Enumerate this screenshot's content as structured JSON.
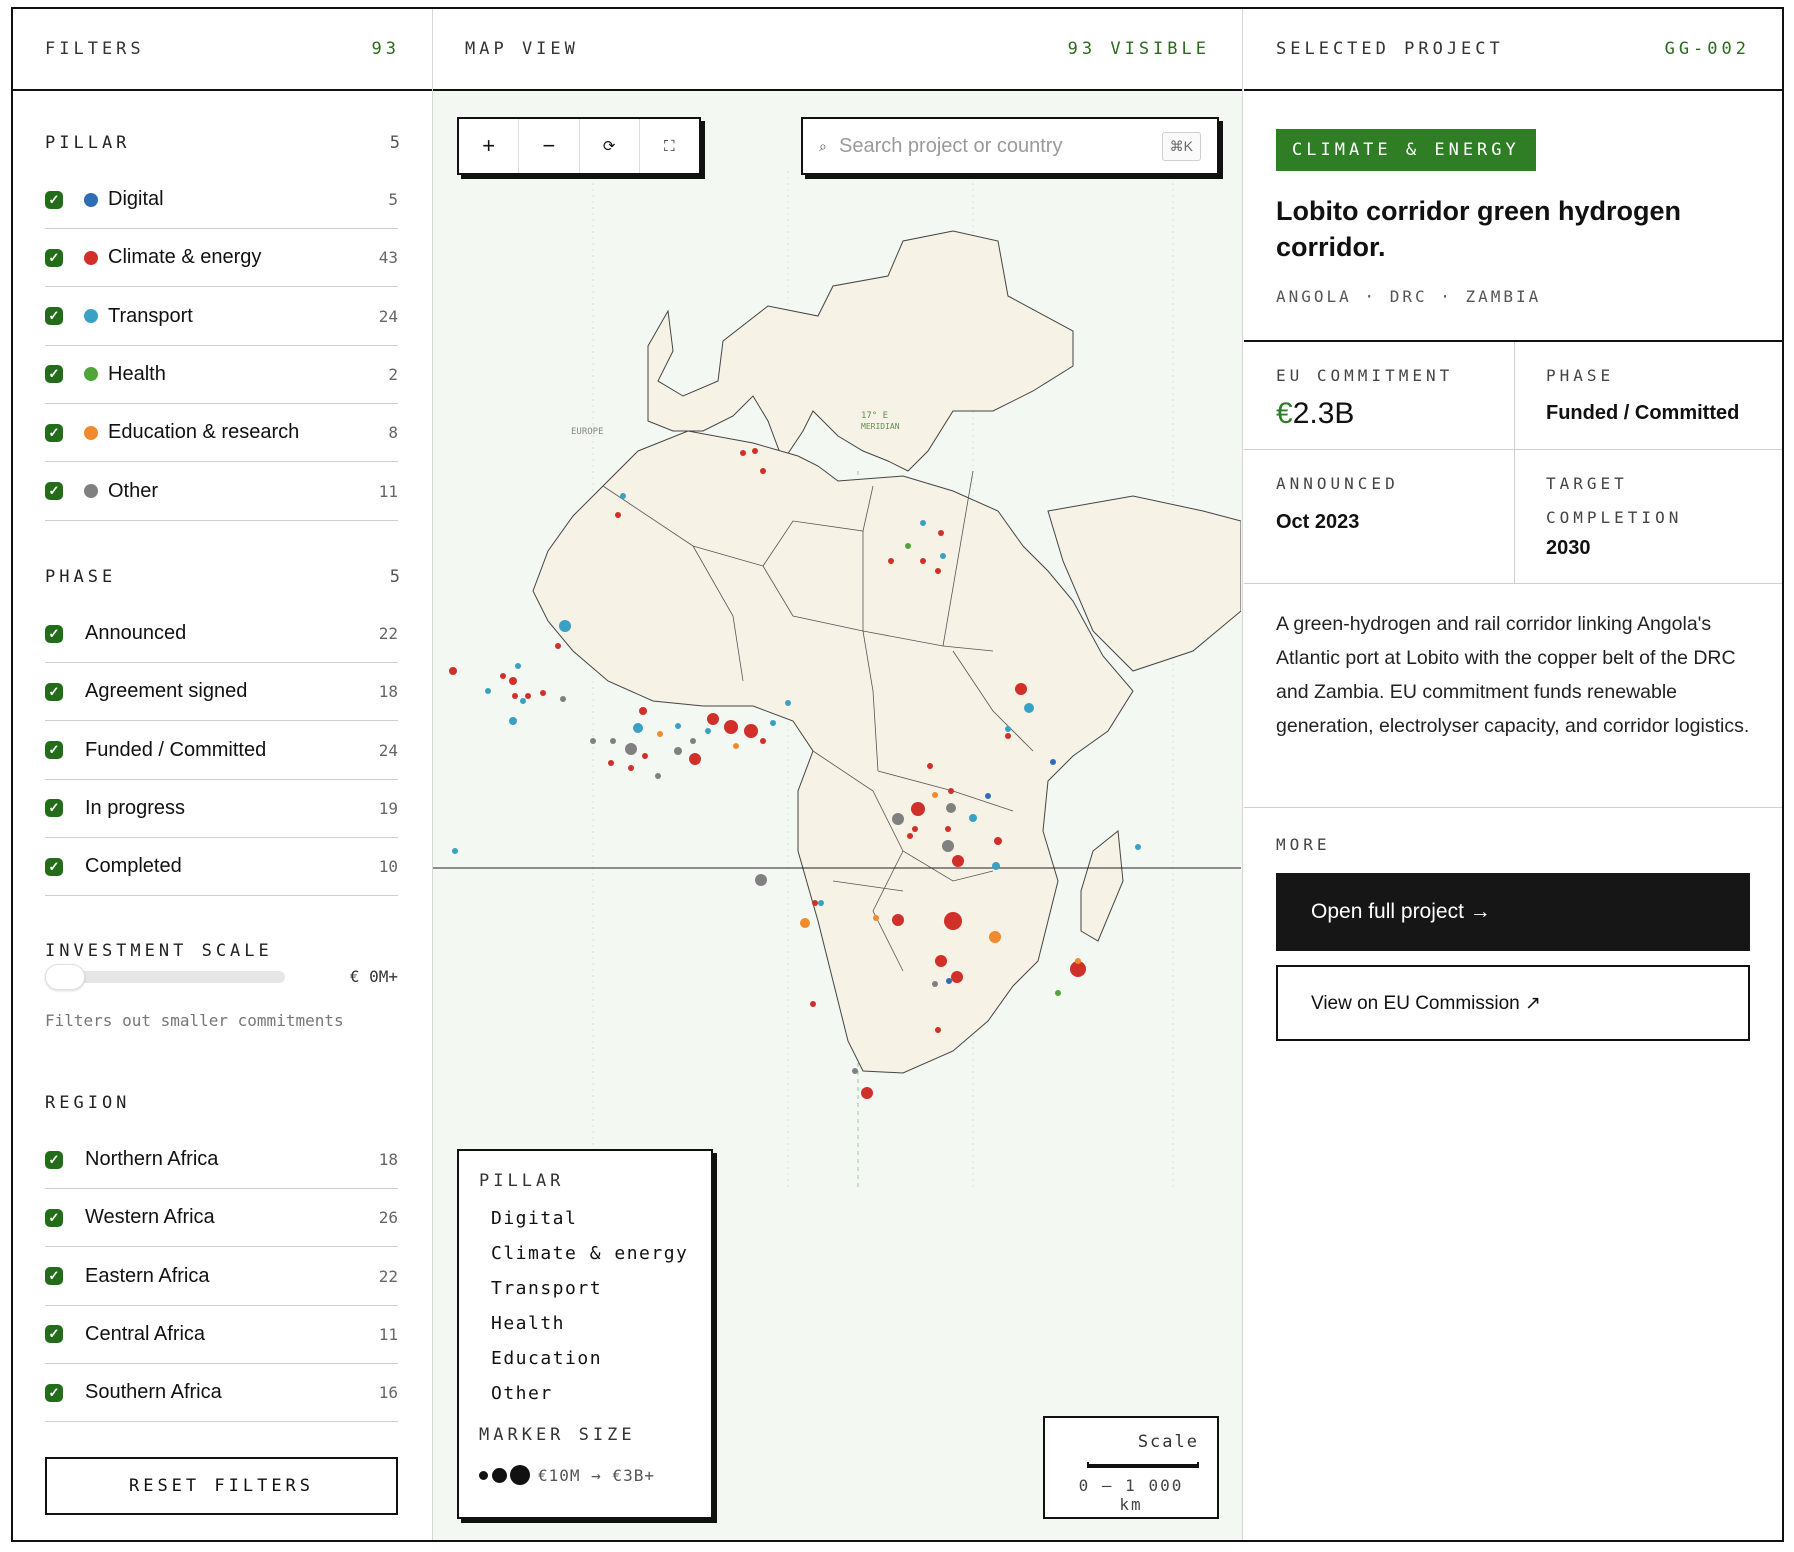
{
  "filters_panel": {
    "header_label": "FILTERS",
    "header_count": "93",
    "pillar": {
      "title": "PILLAR",
      "count": "5",
      "items": [
        {
          "label": "Digital",
          "count": "5",
          "color": "#2f6db5"
        },
        {
          "label": "Climate & energy",
          "count": "43",
          "color": "#d0302a"
        },
        {
          "label": "Transport",
          "count": "24",
          "color": "#3aa0c4"
        },
        {
          "label": "Health",
          "count": "2",
          "color": "#4fa53a"
        },
        {
          "label": "Education & research",
          "count": "8",
          "color": "#f08a2c"
        },
        {
          "label": "Other",
          "count": "11",
          "color": "#808080"
        }
      ]
    },
    "phase": {
      "title": "PHASE",
      "count": "5",
      "items": [
        {
          "label": "Announced",
          "count": "22"
        },
        {
          "label": "Agreement signed",
          "count": "18"
        },
        {
          "label": "Funded / Committed",
          "count": "24"
        },
        {
          "label": "In progress",
          "count": "19"
        },
        {
          "label": "Completed",
          "count": "10"
        }
      ]
    },
    "investment": {
      "title": "INVESTMENT SCALE",
      "value": "€ 0M+",
      "hint": "Filters out smaller commitments",
      "level": 0
    },
    "region": {
      "title": "REGION",
      "items": [
        {
          "label": "Northern Africa",
          "count": "18"
        },
        {
          "label": "Western Africa",
          "count": "26"
        },
        {
          "label": "Eastern Africa",
          "count": "22"
        },
        {
          "label": "Central Africa",
          "count": "11"
        },
        {
          "label": "Southern Africa",
          "count": "16"
        }
      ]
    },
    "reset_label": "RESET FILTERS"
  },
  "map_panel": {
    "header_label": "MAP VIEW",
    "visible_count": "93 VISIBLE",
    "toolbar": {
      "zoom_in": "+",
      "zoom_out": "−",
      "reset": "⟳",
      "fullscreen": "⛶"
    },
    "search": {
      "placeholder": "Search project or country",
      "shortcut": "⌘K"
    },
    "map_labels": {
      "europe": "EUROPE",
      "meridian_1": "17° E",
      "meridian_2": "MERIDIAN"
    },
    "legend": {
      "title": "PILLAR",
      "items": [
        "Digital",
        "Climate & energy",
        "Transport",
        "Health",
        "Education",
        "Other"
      ],
      "marker_title": "MARKER SIZE",
      "marker_range": "€10M → €3B+"
    },
    "scale": {
      "title": "Scale",
      "value": "0 — 1 000 km"
    }
  },
  "project_panel": {
    "header_label": "SELECTED PROJECT",
    "header_id": "GG-002",
    "tag": "CLIMATE & ENERGY",
    "title": "Lobito corridor green hydrogen corridor.",
    "countries": "ANGOLA · DRC · ZAMBIA",
    "eu_commitment_label": "EU COMMITMENT",
    "eu_commitment_currency": "€",
    "eu_commitment_amount": "2.3B",
    "phase_label": "PHASE",
    "phase_value": "Funded / Committed",
    "announced_label": "ANNOUNCED",
    "announced_value": "Oct 2023",
    "target_label_1": "TARGET",
    "target_label_2": "COMPLETION",
    "target_value": "2030",
    "description": "A green-hydrogen and rail corridor linking Angola's Atlantic port at Lobito with the copper belt of the DRC and Zambia. EU commitment funds renewable generation, electrolyser capacity, and corridor logistics.",
    "more_label": "MORE",
    "open_label": "Open full project →",
    "commission_label": "View on EU Commission ↗"
  }
}
